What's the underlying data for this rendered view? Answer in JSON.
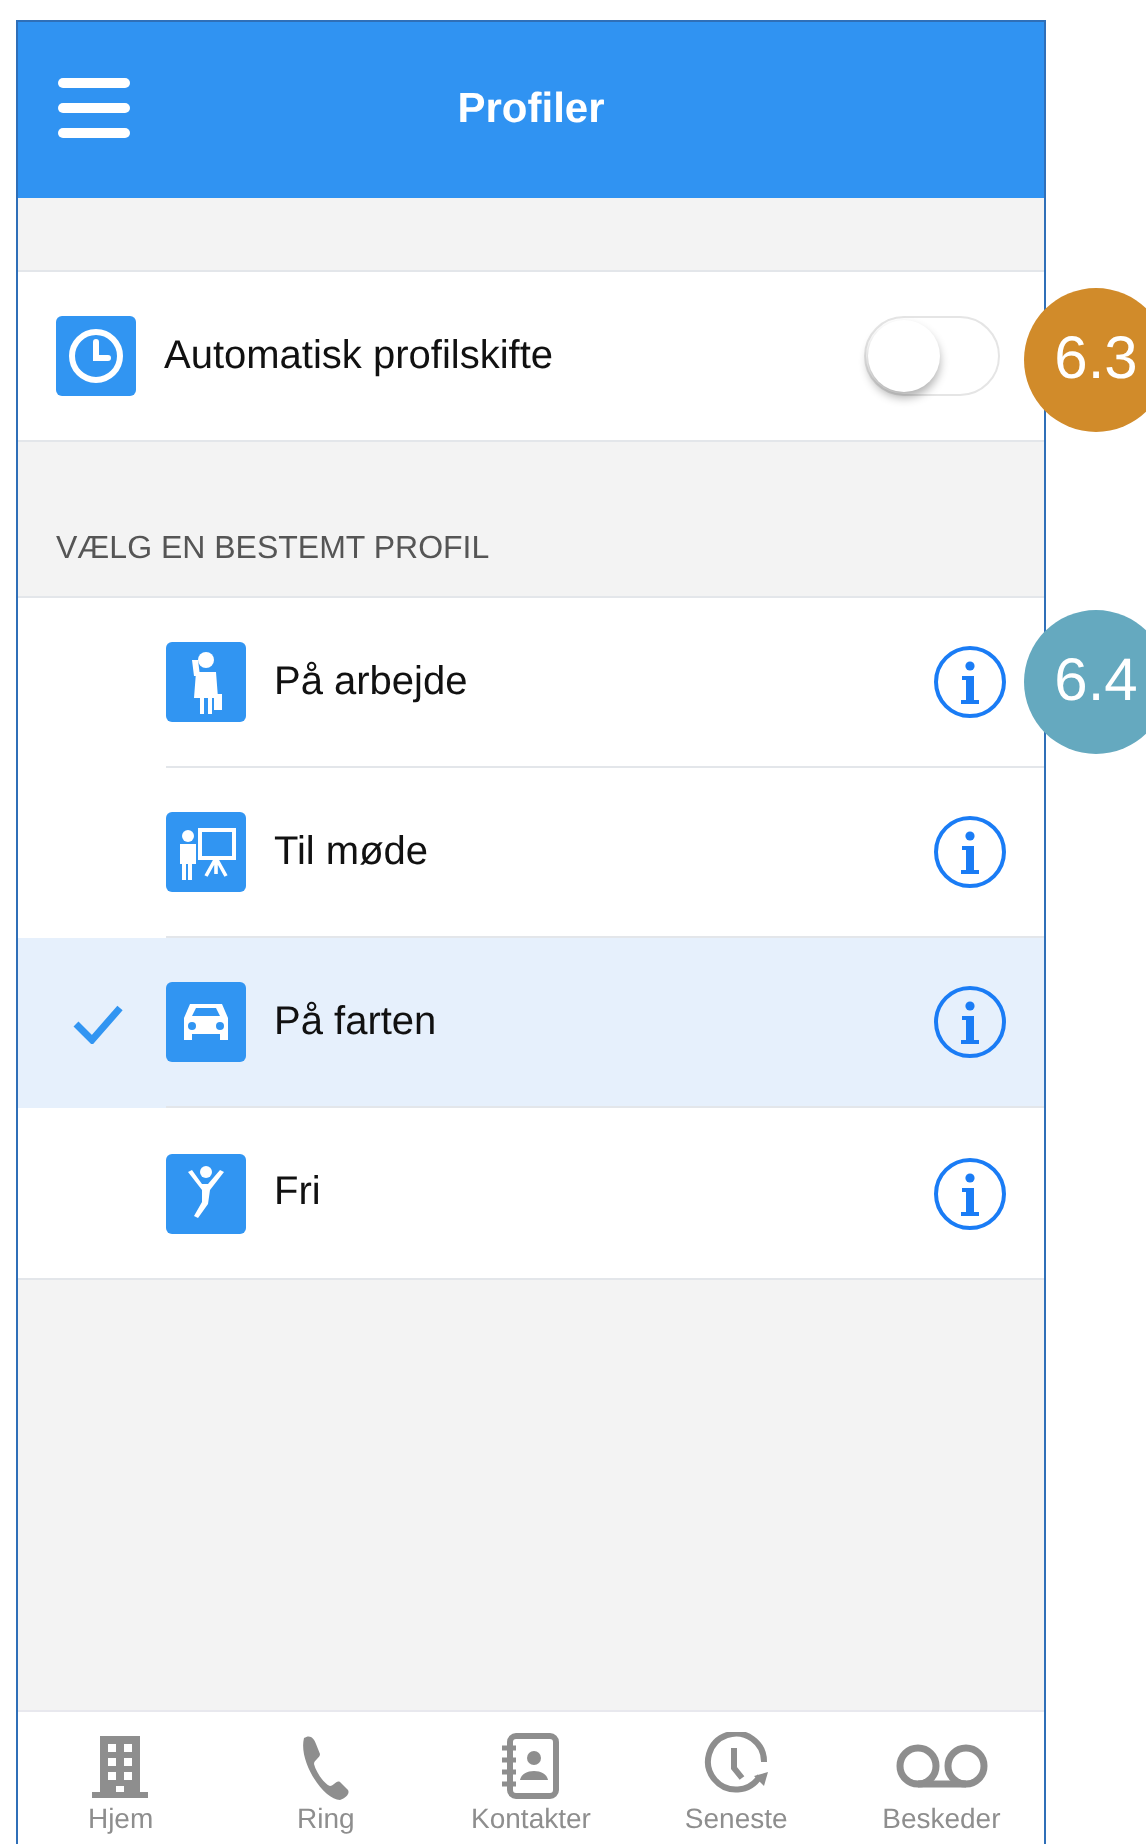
{
  "header": {
    "title": "Profiler"
  },
  "auto_switch": {
    "label": "Automatisk profilskifte",
    "on": false
  },
  "section_label": "VÆLG EN BESTEMT PROFIL",
  "profiles": [
    {
      "label": "På arbejde",
      "kind": "work",
      "selected": false
    },
    {
      "label": "Til møde",
      "kind": "meeting",
      "selected": false
    },
    {
      "label": "På farten",
      "kind": "car",
      "selected": true
    },
    {
      "label": "Fri",
      "kind": "free",
      "selected": false
    }
  ],
  "tab_bar": [
    {
      "label": "Hjem",
      "kind": "home"
    },
    {
      "label": "Ring",
      "kind": "phone"
    },
    {
      "label": "Kontakter",
      "kind": "contacts"
    },
    {
      "label": "Seneste",
      "kind": "recent"
    },
    {
      "label": "Beskeder",
      "kind": "voicemail"
    }
  ],
  "callouts": [
    {
      "label": "6.3",
      "color": "#d18b2a"
    },
    {
      "label": "6.4",
      "color": "#65a9bf"
    }
  ]
}
